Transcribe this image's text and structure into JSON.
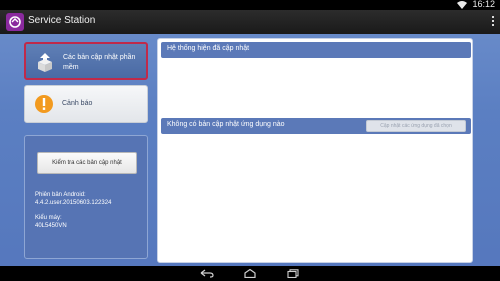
{
  "status_bar": {
    "time": "16:12"
  },
  "app": {
    "title": "Service Station"
  },
  "nav": {
    "items": [
      {
        "label": "Các bản cập nhật phần mềm",
        "selected": true,
        "icon": "package-upload-icon"
      },
      {
        "label": "Cảnh báo",
        "selected": false,
        "icon": "warning-info-icon"
      }
    ]
  },
  "info_panel": {
    "check_button": "Kiểm tra các bản cập nhật",
    "version_label": "Phiên bản Android:",
    "version_value": "4.4.2.user.20150603.122324",
    "model_label": "Kiểu máy:",
    "model_value": "40L5450VN"
  },
  "content": {
    "system_header": "Hệ thống hiện đã cập nhật",
    "apps_header": "Không có bản cập nhật ứng dụng nào",
    "update_selected_button": "Cập nhật các ứng dụng đã chọn"
  },
  "colors": {
    "background": "#5b7fc2",
    "section_header": "#5b79b8",
    "selected_border": "#c02a4a",
    "warning_icon": "#f29a1f"
  }
}
